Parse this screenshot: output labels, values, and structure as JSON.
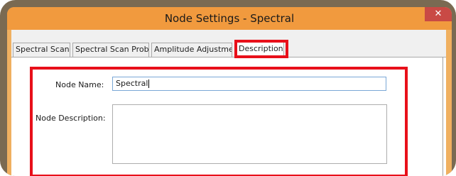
{
  "window": {
    "title": "Node Settings - Spectral",
    "close_label": "✕"
  },
  "tabs": [
    {
      "label": "Spectral Scan"
    },
    {
      "label": "Spectral Scan Probes"
    },
    {
      "label": "Amplitude Adjustment"
    },
    {
      "label": "Description",
      "active": true
    }
  ],
  "form": {
    "name_label": "Node Name:",
    "name_value": "Spectral",
    "description_label": "Node Description:",
    "description_value": ""
  },
  "colors": {
    "titlebar": "#f19a3e",
    "highlight": "#e8101a",
    "close_button": "#c94a45"
  }
}
